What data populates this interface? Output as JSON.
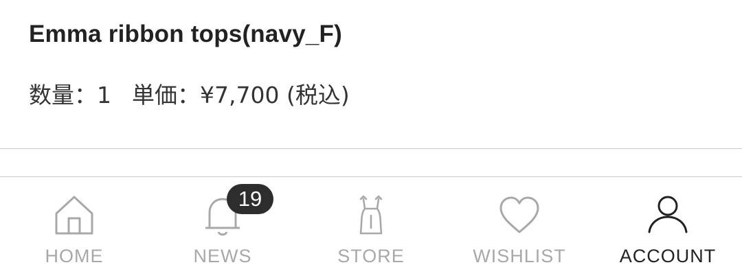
{
  "product": {
    "title": "Emma ribbon tops(navy_F)",
    "quantity_text": "数量：1",
    "price_text": "単価：¥7,700 (税込)"
  },
  "tabbar": {
    "active": "account",
    "items": [
      {
        "key": "home",
        "label": "HOME",
        "icon": "home-icon"
      },
      {
        "key": "news",
        "label": "NEWS",
        "icon": "bell-icon",
        "badge": "19"
      },
      {
        "key": "store",
        "label": "STORE",
        "icon": "dress-icon"
      },
      {
        "key": "wishlist",
        "label": "WISHLIST",
        "icon": "heart-icon"
      },
      {
        "key": "account",
        "label": "ACCOUNT",
        "icon": "person-icon"
      }
    ]
  },
  "colors": {
    "text": "#222222",
    "inactive": "#a8a8a8",
    "badge_bg": "#2d2d2d",
    "divider": "#c8c8c8"
  }
}
